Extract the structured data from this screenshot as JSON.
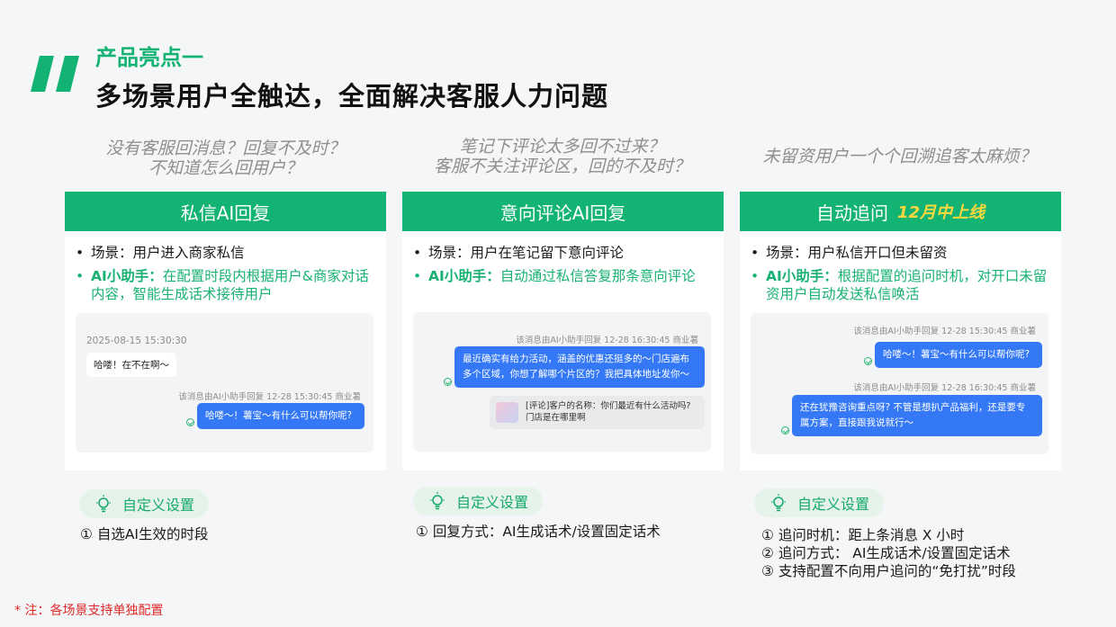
{
  "header": {
    "eyebrow": "产品亮点一",
    "headline": "多场景用户全触达，全面解决客服人力问题"
  },
  "columns": [
    {
      "pain_lines": [
        "没有客服回消息？回复不及时？",
        "不知道怎么回用户？"
      ],
      "title": "私信AI回复",
      "badge": "",
      "scene": "场景：用户进入商家私信",
      "assistant_label": "AI小助手：",
      "assistant_text": "在配置时段内根据用户&商家对话内容，智能生成话术接待用户",
      "chat": {
        "timestamp": "2025-08-15 15:30:30",
        "incoming": "哈喽！在不在啊～",
        "meta": "该消息由AI小助手回复   12-28  15:30:45   商业薯",
        "reply": "哈喽～！薯宝～有什么可以帮你呢?"
      },
      "pill": "自定义设置",
      "notes": [
        "① 自选AI生效的时段"
      ]
    },
    {
      "pain_lines": [
        "笔记下评论太多回不过来？",
        "客服不关注评论区，回的不及时？"
      ],
      "title": "意向评论AI回复",
      "badge": "",
      "scene": "场景：用户在笔记留下意向评论",
      "assistant_label": "AI小助手：",
      "assistant_text": "自动通过私信答复那条意向评论",
      "chat": {
        "meta": "该消息由AI小助手回复   12-28  16:30:45   商业薯",
        "reply": "最近确实有给力活动，涵盖的优惠还挺多的～门店遍布多个区域，你想了解哪个片区的？我把具体地址发你～",
        "comment_line1": "[评论]客户的名称：你们最近有什么活动吗?",
        "comment_line2": "门店是在哪里啊"
      },
      "pill": "自定义设置",
      "notes": [
        "① 回复方式：AI生成话术/设置固定话术"
      ]
    },
    {
      "pain_lines": [
        "未留资用户一个个回溯追客太麻烦？"
      ],
      "title": "自动追问",
      "badge": "12月中上线",
      "scene": "场景：用户私信开口但未留资",
      "assistant_label": "AI小助手：",
      "assistant_text": "根据配置的追问时机，对开口未留资用户自动发送私信唤活",
      "chat": {
        "meta1": "该消息由AI小助手回复   12-28  15:30:45   商业薯",
        "reply1": "哈喽～！薯宝～有什么可以帮你呢?",
        "meta2": "该消息由AI小助手回复   12-28  16:30:45   商业薯",
        "reply2": "还在犹豫咨询重点呀? 不管是想扒产品福利，还是要专属方案，直接跟我说就行～"
      },
      "pill": "自定义设置",
      "notes": [
        "① 追问时机：距上条消息 X 小时",
        "② 追问方式： AI生成话术/设置固定话术",
        "③ 支持配置不向用户追问的“免打扰”时段"
      ]
    }
  ],
  "footnote": "* 注：各场景支持单独配置",
  "colors": {
    "accent": "#13b374",
    "bubble": "#3478f6",
    "badge": "#ffd83d",
    "footnote": "#e02828"
  }
}
